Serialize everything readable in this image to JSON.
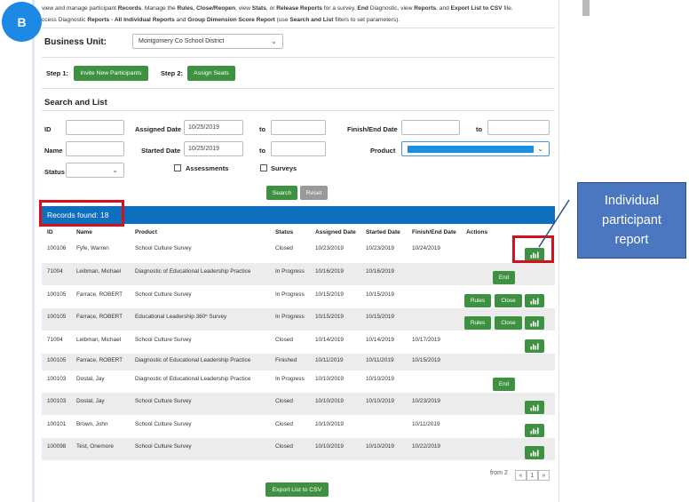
{
  "badge": "B",
  "intro": {
    "line1_pre": "view and manage participant ",
    "line1_b1": "Records",
    "line1_m1": ". Manage the ",
    "line1_b2": "Rules",
    "line1_m2": ", ",
    "line1_b3": "Close/Reopen",
    "line1_m3": ", view ",
    "line1_b4": "Stats",
    "line1_m4": ", or ",
    "line1_b5": "Release Reports",
    "line1_m5": " for a survey. ",
    "line1_b6": "End",
    "line1_m6": " Diagnostic, view ",
    "line1_b7": "Reports",
    "line1_m7": ", and ",
    "line1_b8": "Export List to CSV",
    "line1_m8": " file.",
    "line2_pre": "ccess Diagnostic ",
    "line2_b1": "Reports - All Individual Reports",
    "line2_m1": " and ",
    "line2_b2": "Group Dimension Score Report",
    "line2_m2": " (use ",
    "line2_b3": "Search and List",
    "line2_m3": " filters to set parameters)."
  },
  "business_unit": {
    "label": "Business Unit:",
    "value": "Montgomery Co School District"
  },
  "steps": {
    "step1_label": "Step 1:",
    "step1_button": "Invite New Participants",
    "step2_label": "Step 2:",
    "step2_button": "Assign Seats"
  },
  "search": {
    "title": "Search and List",
    "id_label": "ID",
    "name_label": "Name",
    "status_label": "Status",
    "assigned_label": "Assigned Date",
    "assigned_from": "10/25/2019",
    "started_label": "Started Date",
    "started_from": "10/25/2019",
    "to1": "to",
    "to2": "to",
    "to3": "to",
    "finish_label": "Finish/End Date",
    "product_label": "Product",
    "assessments_label": "Assessments",
    "surveys_label": "Surveys",
    "search_button": "Search",
    "reset_button": "Reset"
  },
  "records": {
    "found": "Records found: 18",
    "headers": [
      "ID",
      "Name",
      "Product",
      "Status",
      "Assigned Date",
      "Started Date",
      "Finish/End Date",
      "Actions"
    ],
    "rows": [
      {
        "id": "100106",
        "name": "Fyfe, Warren",
        "product": "School Culture Survey",
        "status": "Closed",
        "assigned": "10/23/2019",
        "started": "10/23/2019",
        "finish": "10/24/2019"
      },
      {
        "id": "71004",
        "name": "Leibman, Michael",
        "product": "Diagnostic of Educational Leadership Practice",
        "status": "In Progress",
        "assigned": "10/16/2019",
        "started": "10/16/2019",
        "finish": ""
      },
      {
        "id": "100105",
        "name": "Farrace, ROBERT",
        "product": "School Culture Survey",
        "status": "In Progress",
        "assigned": "10/15/2019",
        "started": "10/15/2019",
        "finish": ""
      },
      {
        "id": "100105",
        "name": "Farrace, ROBERT",
        "product": "Educational Leadership 360º Survey",
        "status": "In Progress",
        "assigned": "10/15/2019",
        "started": "10/15/2019",
        "finish": ""
      },
      {
        "id": "71004",
        "name": "Leibman, Michael",
        "product": "School Culture Survey",
        "status": "Closed",
        "assigned": "10/14/2019",
        "started": "10/14/2019",
        "finish": "10/17/2019"
      },
      {
        "id": "100105",
        "name": "Farrace, ROBERT",
        "product": "Diagnostic of Educational Leadership Practice",
        "status": "Finished",
        "assigned": "10/11/2019",
        "started": "10/11/2019",
        "finish": "10/15/2019"
      },
      {
        "id": "100103",
        "name": "Dostal, Jay",
        "product": "Diagnostic of Educational Leadership Practice",
        "status": "In Progress",
        "assigned": "10/10/2019",
        "started": "10/10/2019",
        "finish": ""
      },
      {
        "id": "100103",
        "name": "Dostal, Jay",
        "product": "School Culture Survey",
        "status": "Closed",
        "assigned": "10/10/2019",
        "started": "10/10/2019",
        "finish": "10/23/2019"
      },
      {
        "id": "100101",
        "name": "Brown, John",
        "product": "School Culture Survey",
        "status": "Closed",
        "assigned": "10/10/2019",
        "started": "",
        "finish": "10/11/2019"
      },
      {
        "id": "100098",
        "name": "Test, Onemore",
        "product": "School Culture Survey",
        "status": "Closed",
        "assigned": "10/10/2019",
        "started": "10/10/2019",
        "finish": "10/22/2019"
      }
    ],
    "end_label": "End",
    "rules_label": "Rules",
    "close_label": "Close"
  },
  "pagination": {
    "from_label": "from 2",
    "prev": "«",
    "page": "1",
    "next": "»"
  },
  "export_button": "Export List to CSV",
  "callout": {
    "line1": "Individual",
    "line2": "participant",
    "line3": "report"
  },
  "colors": {
    "accent_green": "#3d9140",
    "records_bar": "#0e6fbf",
    "highlight_red": "#d8101d",
    "callout_blue": "#4a77bf",
    "badge_blue": "#1e88e5"
  }
}
